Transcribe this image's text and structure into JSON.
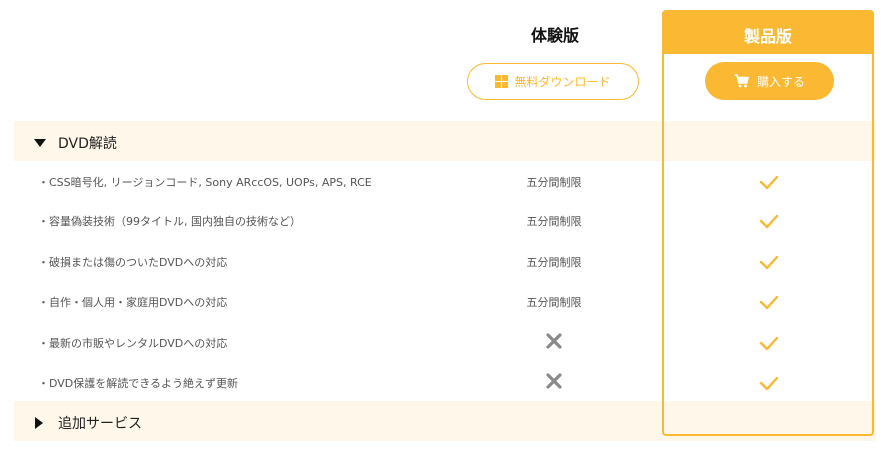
{
  "header": {
    "trial_title": "体験版",
    "product_title": "製品版",
    "download_label": "無料ダウンロード",
    "buy_label": "購入する"
  },
  "sections": {
    "dvd_title": "DVD解読",
    "extra_title": "追加サービス"
  },
  "features": [
    {
      "label": "・CSS暗号化, リージョンコード, Sony ARccOS, UOPs, APS, RCE",
      "trial": "五分間制限",
      "trial_available": true,
      "product_available": true
    },
    {
      "label": "・容量偽装技術（99タイトル, 国内独自の技術など）",
      "trial": "五分間制限",
      "trial_available": true,
      "product_available": true
    },
    {
      "label": "・破損または傷のついたDVDへの対応",
      "trial": "五分間制限",
      "trial_available": true,
      "product_available": true
    },
    {
      "label": "・自作・個人用・家庭用DVDへの対応",
      "trial": "五分間制限",
      "trial_available": true,
      "product_available": true
    },
    {
      "label": "・最新の市販やレンタルDVDへの対応",
      "trial": "",
      "trial_available": false,
      "product_available": true
    },
    {
      "label": "・DVD保護を解読できるよう絶えず更新",
      "trial": "",
      "trial_available": false,
      "product_available": true
    }
  ],
  "icons": {
    "download": "windows-icon",
    "buy": "cart-icon",
    "unavailable": "cross-icon",
    "available": "check-icon",
    "expanded": "triangle-down-icon",
    "collapsed": "triangle-right-icon"
  },
  "colors": {
    "accent": "#fbb832",
    "band": "#fef7ea",
    "cross": "#8a8a8a"
  }
}
